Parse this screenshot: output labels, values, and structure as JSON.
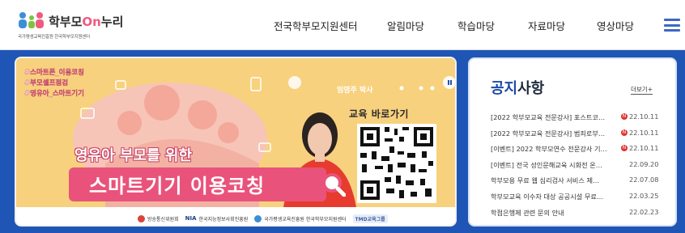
{
  "brand": {
    "title_prefix": "학부모",
    "title_on": "On",
    "title_suffix": "누리",
    "subtitle": "국가평생교육진흥원 한국학부모지원센터",
    "accent": "#1f55b5",
    "pink": "#e9537b"
  },
  "nav": {
    "items": [
      "전국학부모지원센터",
      "알림마당",
      "학습마당",
      "자료마당",
      "영상마당"
    ],
    "menu_icon": "hamburger-icon"
  },
  "banner": {
    "hashtags": [
      "#스마트폰_이용코칭",
      "#부모셀프점검",
      "#영유아_스마트기기"
    ],
    "speaker": "임영주 박사",
    "edu_link": "교육 바로가기",
    "title_line1": "영유아 부모를 위한",
    "title_line2": "스마트기기 이용코칭",
    "partners": [
      "방송통신위원회",
      "한국지능정보사회진흥원",
      "국가평생교육진흥원 한국학부모지원센터",
      "TMD교육그룹"
    ],
    "partner_nia": "NIA"
  },
  "notice": {
    "title_blue": "공지",
    "title_dark": "사항",
    "more_label": "더보기+",
    "items": [
      {
        "title": "[2022 학부모교육 전문강사] 포스트코…",
        "date": "22.10.11",
        "new": true
      },
      {
        "title": "[2022 학부모교육 전문강사] 범죄로부…",
        "date": "22.10.11",
        "new": true
      },
      {
        "title": "[이벤트] 2022 학부모연수 전문강사 기…",
        "date": "22.10.11",
        "new": true
      },
      {
        "title": "[이벤트] 전국 성인문해교육 시화전 온…",
        "date": "22.09.20",
        "new": false
      },
      {
        "title": "학부모용 무료 웹 심리검사 서비스 제…",
        "date": "22.07.08",
        "new": false
      },
      {
        "title": "학부모교육 이수자 대상 공공시설 무료…",
        "date": "22.03.25",
        "new": false
      },
      {
        "title": "학점은행제 관련 문의 안내",
        "date": "22.02.23",
        "new": false
      }
    ]
  }
}
